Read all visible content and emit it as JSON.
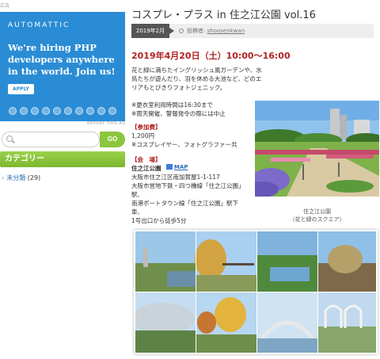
{
  "sidebar": {
    "ad_label": "広告",
    "ad": {
      "logo": "AUTOMATTIC",
      "headline": "We're hiring PHP developers anywhere in the world. Join us!",
      "apply_label": "APPLY"
    },
    "report_ad": "REPORT THIS AD",
    "search": {
      "value": "",
      "button_label": "GO"
    },
    "category_heading": "カテゴリー",
    "categories": [
      {
        "label": "未分類",
        "count": "(29)"
      }
    ]
  },
  "post": {
    "title": "コスプレ・プラス in 住之江公園 vol.16",
    "date_badge": "2019年2月",
    "author_prefix": "投稿者:",
    "author": "shoosenkwan",
    "event_date": "2019年4月20日（土）10:00～16:00",
    "description": "花と緑に満ちたイングリッシュ風ガーデンや、水鳥たちが遊んだり、羽を休める大池など、どのエリアもとびきりフォトジェニック。",
    "note1": "※更衣室利用時間は16:30まで",
    "note2": "※雨天開催、警報発令の際には中止",
    "fee_heading": "【参加費】",
    "fee_amount": "1,200円",
    "fee_note": "※コスプレイヤー、フォトグラファー共",
    "venue_heading": "【会　場】",
    "venue_name": "住之江公園",
    "map_label": "MAP",
    "address": "大阪市住之江区南加賀屋1-1-117",
    "access1": "大阪市営地下鉄・四つ橋線「住之江公園」駅、",
    "access2": "南港ポートタウン線「住之江公園」駅下車、",
    "access3": "1号出口から徒歩5分",
    "caption_line1": "住之江公園",
    "caption_line2": "（花と緑のスクエア）"
  },
  "colors": {
    "ad_blue": "#2a8cd4",
    "green": "#8cc63e",
    "red": "#b22222",
    "badge": "#555555"
  }
}
